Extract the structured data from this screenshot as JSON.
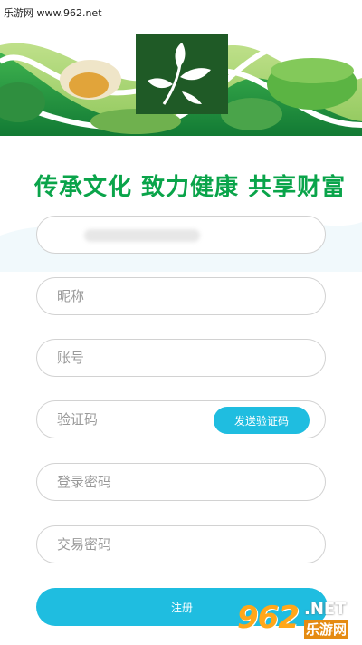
{
  "watermark": {
    "top_text": "乐游网 www.962.net",
    "badge_number": "962",
    "badge_domain": ".NET",
    "badge_name": "乐游网"
  },
  "banner": {
    "slogan": "传承文化 致力健康 共享财富"
  },
  "form": {
    "phone_value": "",
    "nickname_placeholder": "昵称",
    "account_placeholder": "账号",
    "verify_code_placeholder": "验证码",
    "send_code_label": "发送验证码",
    "login_password_placeholder": "登录密码",
    "trade_password_placeholder": "交易密码",
    "register_label": "注册"
  },
  "colors": {
    "accent": "#1fbde0",
    "brand_green": "#0aa44a",
    "logo_bg": "#1f5a26"
  }
}
